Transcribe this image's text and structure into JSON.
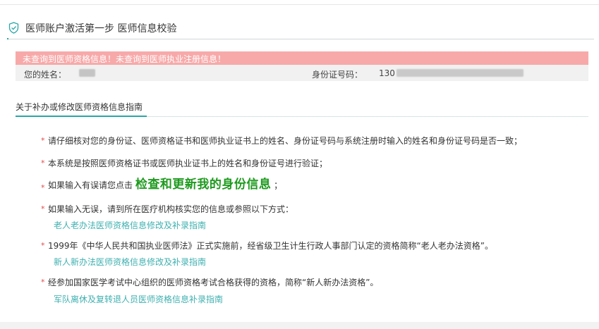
{
  "header": {
    "title": "医师账户激活第一步 医师信息校验",
    "icon": "shield-check-icon",
    "accent_color": "#29a6a6"
  },
  "alert": {
    "message": "未查询到医师资格信息！未查询到医师执业注册信息！",
    "color": "#f7a9a9"
  },
  "account_info": {
    "name_label": "您的姓名：",
    "id_label": "身份证号码：",
    "id_prefix": "130"
  },
  "guide": {
    "title": "关于补办或修改医师资格信息指南",
    "items": [
      {
        "text": "请仔细核对您的身份证、医师资格证书和医师执业证书上的姓名、身份证号码与系统注册时输入的姓名和身份证号码是否一致；"
      },
      {
        "text": "本系统是按照医师资格证书或医师执业证书上的姓名和身份证号进行验证；"
      },
      {
        "text_before": "如果输入有误请您点击",
        "link": "检查和更新我的身份信息",
        "text_after": "；"
      },
      {
        "text": "如果输入无误，请到所在医疗机构核实您的信息或参照以下方式：",
        "sub_link": "老人老办法医师资格信息修改及补录指南"
      },
      {
        "text": "1999年《中华人民共和国执业医师法》正式实施前，经省级卫生计生行政人事部门认定的资格简称“老人老办法资格”。",
        "sub_link": "新人新办法医师资格信息修改及补录指南"
      },
      {
        "text": "经参加国家医学考试中心组织的医师资格考试合格获得的资格，简称“新人新办法资格”。",
        "sub_link": "军队离休及复转退人员医师资格信息补录指南"
      }
    ]
  },
  "bullet_symbol": "*",
  "link_color": "#3fb0b0",
  "highlight_link_color": "#1e9a1e"
}
